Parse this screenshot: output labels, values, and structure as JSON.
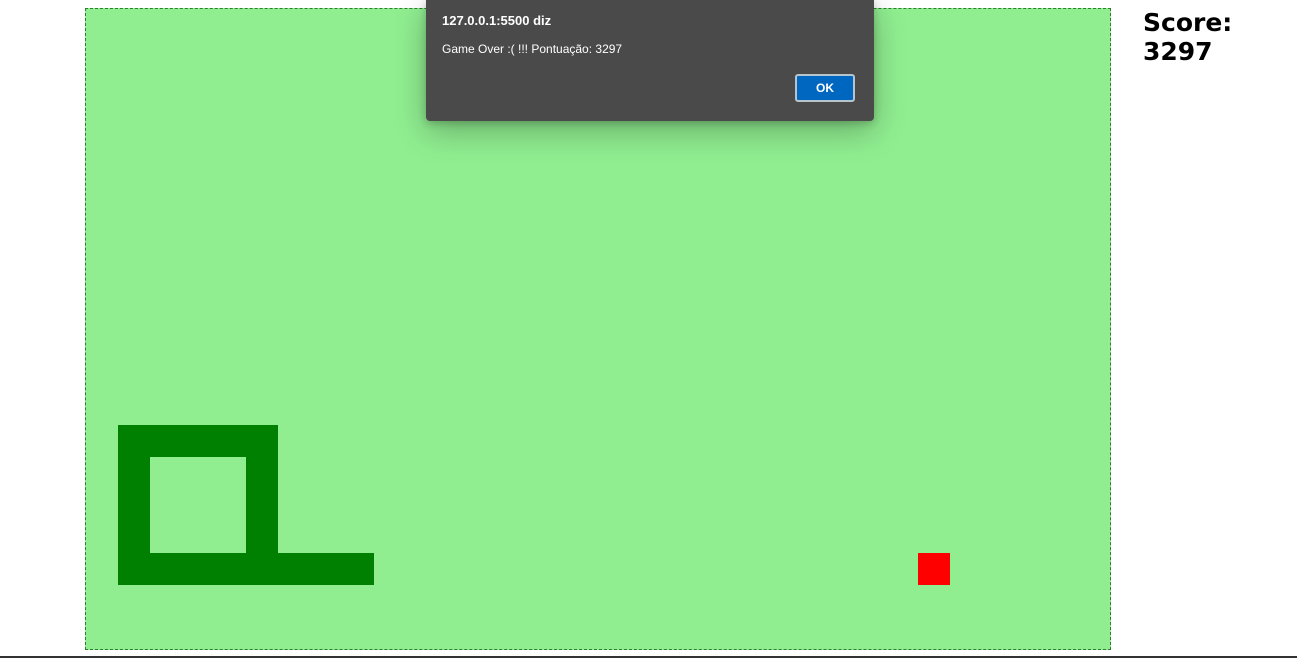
{
  "game": {
    "board_color": "#90ee90",
    "snake_color": "#008000",
    "food_color": "#ff0000",
    "snake_cells": [
      [
        1,
        13
      ],
      [
        2,
        13
      ],
      [
        3,
        13
      ],
      [
        4,
        13
      ],
      [
        5,
        13
      ],
      [
        1,
        14
      ],
      [
        5,
        14
      ],
      [
        1,
        15
      ],
      [
        5,
        15
      ],
      [
        1,
        16
      ],
      [
        5,
        16
      ],
      [
        1,
        17
      ],
      [
        2,
        17
      ],
      [
        3,
        17
      ],
      [
        4,
        17
      ],
      [
        5,
        17
      ],
      [
        6,
        17
      ],
      [
        7,
        17
      ],
      [
        8,
        17
      ]
    ],
    "food_cell": [
      26,
      17
    ]
  },
  "score": {
    "label": "Score:",
    "value": "3297"
  },
  "alert": {
    "title": "127.0.0.1:5500 diz",
    "message": "Game Over :( !!! Pontuação: 3297",
    "ok_label": "OK",
    "accent_color": "#0067c0"
  }
}
